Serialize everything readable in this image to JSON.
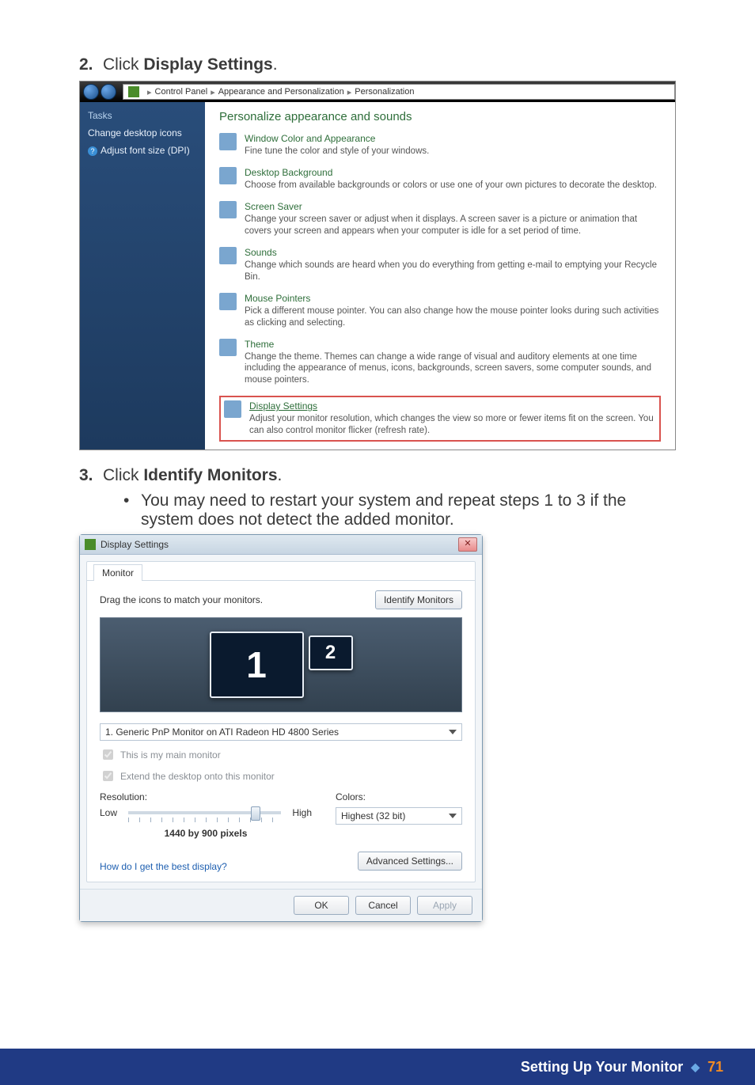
{
  "steps": {
    "s2_num": "2.",
    "s2_text_prefix": "Click ",
    "s2_text_bold": "Display Settings",
    "s2_text_suffix": ".",
    "s3_num": "3.",
    "s3_text_prefix": "Click ",
    "s3_text_bold": "Identify Monitors",
    "s3_text_suffix": ".",
    "bullet": "You may need to restart your system and repeat steps 1 to 3 if the system does not detect the added monitor."
  },
  "cp": {
    "breadcrumb": {
      "a": "Control Panel",
      "b": "Appearance and Personalization",
      "c": "Personalization"
    },
    "side": {
      "title": "Tasks",
      "link1": "Change desktop icons",
      "link2": "Adjust font size (DPI)"
    },
    "heading": "Personalize appearance and sounds",
    "items": [
      {
        "title": "Window Color and Appearance",
        "desc": "Fine tune the color and style of your windows."
      },
      {
        "title": "Desktop Background",
        "desc": "Choose from available backgrounds or colors or use one of your own pictures to decorate the desktop."
      },
      {
        "title": "Screen Saver",
        "desc": "Change your screen saver or adjust when it displays. A screen saver is a picture or animation that covers your screen and appears when your computer is idle for a set period of time."
      },
      {
        "title": "Sounds",
        "desc": "Change which sounds are heard when you do everything from getting e-mail to emptying your Recycle Bin."
      },
      {
        "title": "Mouse Pointers",
        "desc": "Pick a different mouse pointer. You can also change how the mouse pointer looks during such activities as clicking and selecting."
      },
      {
        "title": "Theme",
        "desc": "Change the theme. Themes can change a wide range of visual and auditory elements at one time including the appearance of menus, icons, backgrounds, screen savers, some computer sounds, and mouse pointers."
      },
      {
        "title": "Display Settings",
        "desc": "Adjust your monitor resolution, which changes the view so more or fewer items fit on the screen. You can also control monitor flicker (refresh rate)."
      }
    ]
  },
  "ds": {
    "title": "Display Settings",
    "tab": "Monitor",
    "drag_label": "Drag the icons to match your monitors.",
    "identify_btn": "Identify Monitors",
    "mon1": "1",
    "mon2": "2",
    "monitor_select": "1. Generic PnP Monitor on ATI Radeon HD 4800 Series",
    "check_main": "This is my main monitor",
    "check_extend": "Extend the desktop onto this monitor",
    "res_label": "Resolution:",
    "low": "Low",
    "high": "High",
    "res_value": "1440 by 900 pixels",
    "colors_label": "Colors:",
    "colors_value": "Highest (32 bit)",
    "help_link": "How do I get the best display?",
    "adv_btn": "Advanced Settings...",
    "ok": "OK",
    "cancel": "Cancel",
    "apply": "Apply",
    "close_x": "✕"
  },
  "footer": {
    "section": "Setting Up Your Monitor",
    "page": "71"
  }
}
